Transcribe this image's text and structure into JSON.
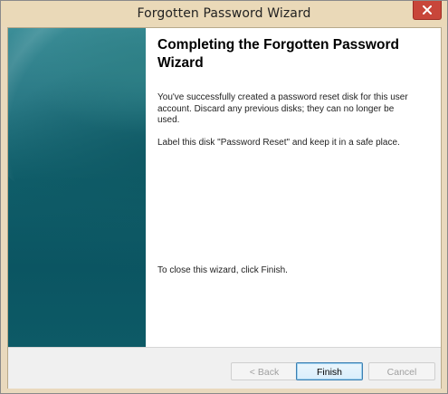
{
  "window": {
    "title": "Forgotten Password Wizard",
    "close_icon": "close-icon"
  },
  "content": {
    "heading": "Completing the Forgotten Password Wizard",
    "paragraph1": "You've successfully created a password reset disk for this user account. Discard any previous disks; they can no longer be used.",
    "paragraph2": "Label this disk \"Password Reset\" and keep it in a safe place.",
    "paragraph3": "To close this wizard, click Finish."
  },
  "buttons": {
    "back": "< Back",
    "finish": "Finish",
    "cancel": "Cancel"
  },
  "colors": {
    "titlebar": "#ead9b8",
    "close_button": "#c8463a",
    "side_panel": "#0f5d69",
    "default_button_border": "#3c7fb1"
  }
}
